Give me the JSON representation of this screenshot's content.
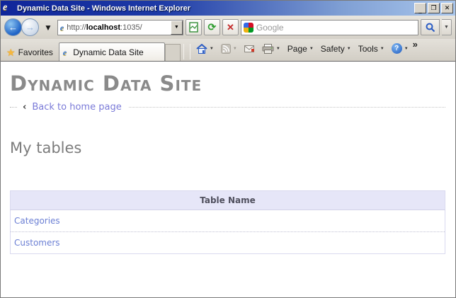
{
  "window": {
    "title": "Dynamic Data Site - Windows Internet Explorer"
  },
  "icons": {
    "back": "←",
    "forward": "→",
    "dropdown": "▼",
    "refresh": "⟳",
    "stop": "✕",
    "star": "★",
    "help": "?",
    "chevron_more": "»",
    "close": "✕",
    "maximize": "❐",
    "minimize": "_",
    "address_drop": "▼"
  },
  "address_bar": {
    "url_prefix": "http://",
    "url_host": "localhost",
    "url_suffix": ":1035/",
    "search_placeholder": "Google"
  },
  "favorites_bar": {
    "favorites_label": "Favorites",
    "tab_title": "Dynamic Data Site",
    "menus": [
      {
        "label": "Page"
      },
      {
        "label": "Safety"
      },
      {
        "label": "Tools"
      }
    ]
  },
  "page": {
    "site_title": "Dynamic Data Site",
    "back_arrow": "‹",
    "back_link": "Back to home page",
    "heading": "My tables",
    "table": {
      "header": "Table Name",
      "rows": [
        {
          "label": "Categories"
        },
        {
          "label": "Customers"
        }
      ]
    }
  },
  "colors": {
    "titlebar_start": "#10269a",
    "titlebar_end": "#aac7ec",
    "chrome": "#d8d4cb",
    "table_header_bg": "#e6e6f8",
    "link": "#6b7fd4",
    "back_link": "#7a7ad8",
    "heading_gray": "#8a8a8a"
  }
}
